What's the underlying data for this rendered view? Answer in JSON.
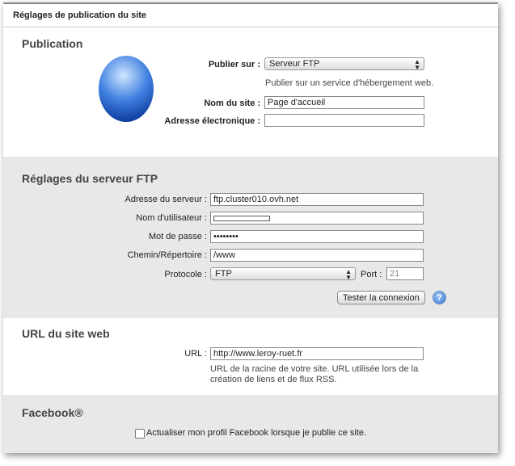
{
  "window": {
    "title": "Réglages de publication du site"
  },
  "publication": {
    "heading": "Publication",
    "publish_on_label": "Publier sur :",
    "publish_on_value": "Serveur FTP",
    "publish_hint": "Publier sur un service d'hébergement web.",
    "site_name_label": "Nom du site :",
    "site_name_value": "Page d'accueil",
    "email_label": "Adresse électronique :",
    "email_value": ""
  },
  "ftp": {
    "heading": "Réglages du serveur FTP",
    "server_label": "Adresse du serveur :",
    "server_value": "ftp.cluster010.ovh.net",
    "user_label": "Nom d'utilisateur :",
    "password_label": "Mot de passe :",
    "password_value": "••••••••",
    "path_label": "Chemin/Répertoire :",
    "path_value": "/www",
    "protocol_label": "Protocole :",
    "protocol_value": "FTP",
    "port_label": "Port :",
    "port_value": "21",
    "test_button": "Tester la connexion",
    "help": "?"
  },
  "url": {
    "heading": "URL du site web",
    "url_label": "URL :",
    "url_value": "http://www.leroy-ruet.fr",
    "hint_line1": "URL de la racine de votre site. URL utilisée lors de la",
    "hint_line2": "création de liens et de flux RSS."
  },
  "facebook": {
    "heading": "Facebook®",
    "checkbox_label": "Actualiser mon profil Facebook lorsque je publie ce site.",
    "checked": false
  }
}
